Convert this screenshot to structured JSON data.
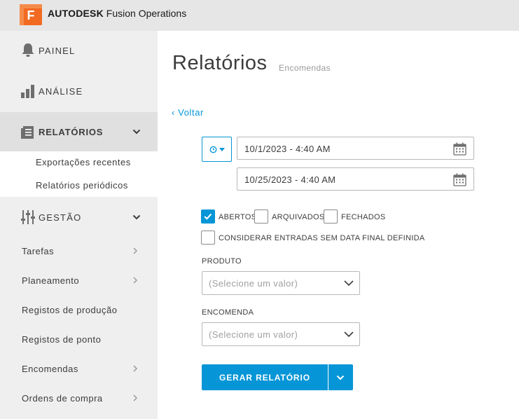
{
  "brand": {
    "name_bold": "AUTODESK",
    "name_rest": " Fusion Operations",
    "logo_letter": "F",
    "logo_color": "#f26a21"
  },
  "sidebar": {
    "panel": "PAINEL",
    "analysis": "ANÁLISE",
    "reports": "RELATÓRIOS",
    "reports_sub": [
      "Exportações recentes",
      "Relatórios periódicos"
    ],
    "management": "GESTÃO",
    "management_items": [
      "Tarefas",
      "Planeamento",
      "Registos de produção",
      "Registos de ponto",
      "Encomendas",
      "Ordens de compra"
    ]
  },
  "main": {
    "title": "Relatórios",
    "subtitle": "Encomendas",
    "back": "‹ Voltar",
    "date_start": "10/1/2023 - 4:40 AM",
    "date_end": "10/25/2023 - 4:40 AM",
    "checks": {
      "open": "ABERTOS",
      "archived": "ARQUIVADOS",
      "closed": "FECHADOS",
      "no_end_date": "CONSIDERAR ENTRADAS SEM DATA FINAL DEFINIDA"
    },
    "product_label": "PRODUTO",
    "product_placeholder": "(Selecione um valor)",
    "order_label": "ENCOMENDA",
    "order_placeholder": "(Selecione um valor)",
    "generate": "GERAR RELATÓRIO"
  },
  "colors": {
    "accent": "#0696d7",
    "sidebar_bg": "#efefef",
    "topbar_bg": "#e6e6e6"
  }
}
